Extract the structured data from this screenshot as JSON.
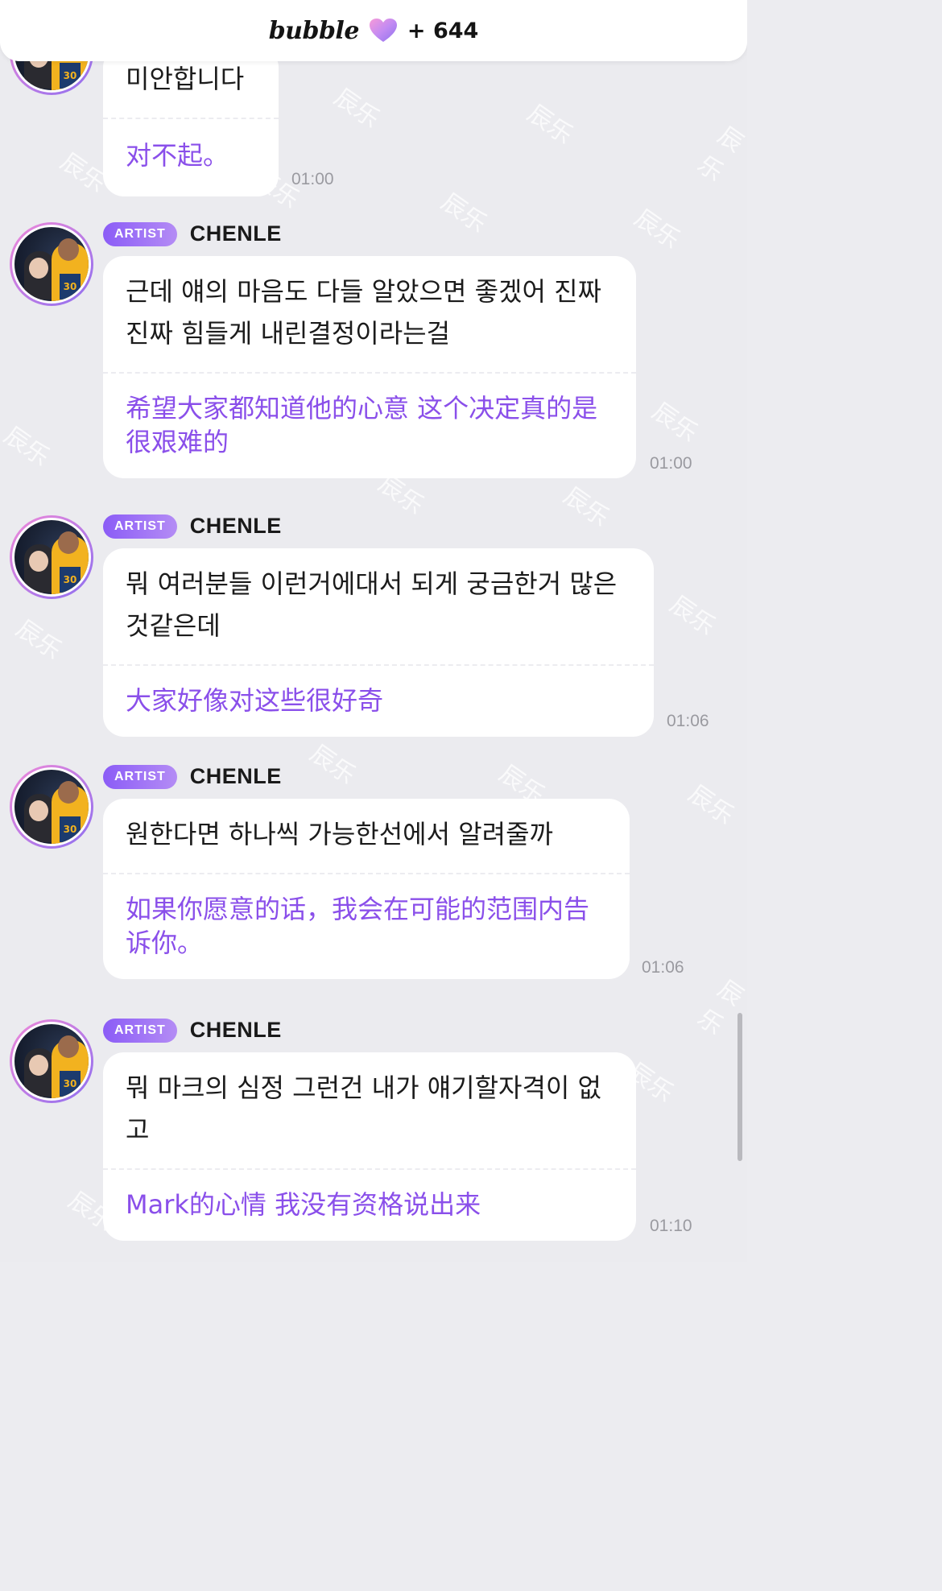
{
  "header": {
    "brand": "bubble",
    "count": "+ 644"
  },
  "colors": {
    "accent": "#8a4fea",
    "badge_start": "#8b5cf6",
    "badge_end": "#b48cf5",
    "background": "#ebebef"
  },
  "messages": [
    {
      "korean": "미안합니다",
      "chinese": "对不起。",
      "time": "01:00"
    },
    {
      "badge": "ARTIST",
      "sender": "CHENLE",
      "korean": "근데 얘의 마음도 다들 알았으면 좋겠어 진짜 진짜 힘들게 내린결정이라는걸",
      "chinese": "希望大家都知道他的心意 这个决定真的是很艰难的",
      "time": "01:00"
    },
    {
      "badge": "ARTIST",
      "sender": "CHENLE",
      "korean": "뭐 여러분들 이런거에대서 되게 궁금한거 많은것같은데",
      "chinese": "大家好像对这些很好奇",
      "time": "01:06"
    },
    {
      "badge": "ARTIST",
      "sender": "CHENLE",
      "korean": "원한다면 하나씩 가능한선에서 알려줄까",
      "chinese": "如果你愿意的话，我会在可能的范围内告诉你。",
      "time": "01:06"
    },
    {
      "badge": "ARTIST",
      "sender": "CHENLE",
      "korean": "뭐 마크의 심정 그런건 내가 얘기할자격이 없고",
      "chinese": "Mark的心情 我没有资格说出来",
      "time": "01:10"
    }
  ],
  "watermark": "辰乐",
  "icons": {
    "heart": "heart-icon",
    "avatar": "avatar-image"
  }
}
